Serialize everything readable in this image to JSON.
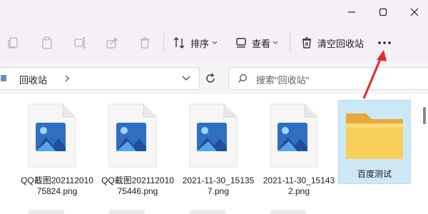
{
  "window": {
    "minimize_icon": "minimize-icon",
    "maximize_icon": "maximize-icon",
    "close_icon": "close-icon"
  },
  "toolbar": {
    "sort_label": "排序",
    "view_label": "查看",
    "empty_recycle_label": "清空回收站",
    "more_label": "..."
  },
  "address": {
    "path": "回收站",
    "search_placeholder": "搜索\"回收站\""
  },
  "files": [
    {
      "name": "QQ截图20211201075824.png",
      "type": "image"
    },
    {
      "name": "QQ截图20211201075446.png",
      "type": "image"
    },
    {
      "name": "2021-11-30_151357.png",
      "type": "image"
    },
    {
      "name": "2021-11-30_151432.png",
      "type": "image"
    },
    {
      "name": "百度测试",
      "type": "folder",
      "selected": true
    }
  ],
  "colors": {
    "annotation_arrow": "#e02b2b",
    "selection": "#cce8f6",
    "folder": "#f6c34a"
  }
}
